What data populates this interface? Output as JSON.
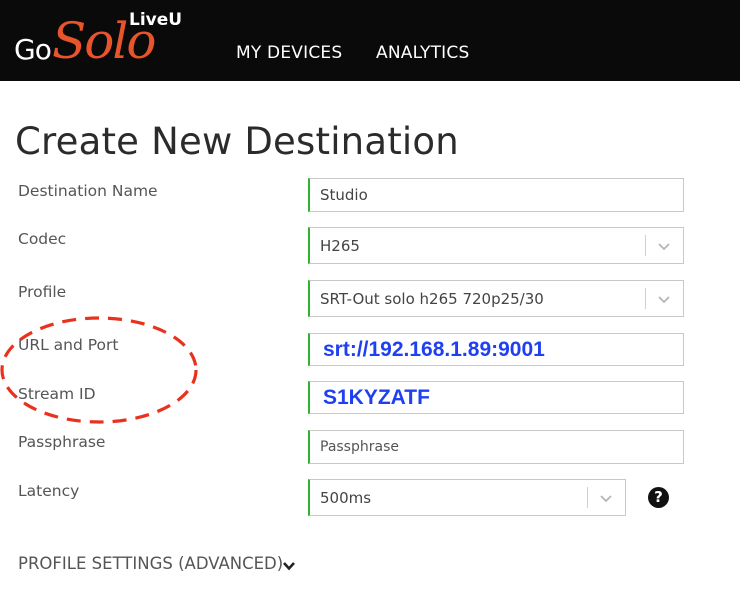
{
  "brand": {
    "go": "Go",
    "solo": "Solo",
    "liveu": "LiveU",
    "accent_color": "#e8542b"
  },
  "nav": {
    "items": [
      "MY DEVICES",
      "ANALYTICS"
    ]
  },
  "page": {
    "title": "Create New Destination"
  },
  "form": {
    "destination_name": {
      "label": "Destination Name",
      "value": "Studio"
    },
    "codec": {
      "label": "Codec",
      "value": "H265"
    },
    "profile": {
      "label": "Profile",
      "value": "SRT-Out solo h265 720p25/30"
    },
    "url_port": {
      "label": "URL and Port",
      "value": "srt://192.168.1.89:9001"
    },
    "stream_id": {
      "label": "Stream ID",
      "value": "S1KYZATF"
    },
    "passphrase": {
      "label": "Passphrase",
      "placeholder": "Passphrase"
    },
    "latency": {
      "label": "Latency",
      "value": "500ms"
    },
    "valid_color": "#2db52d",
    "help_icon": "question-circle-icon"
  },
  "advanced": {
    "label": "PROFILE SETTINGS (ADVANCED)",
    "icon": "chevron-down-icon"
  },
  "annotation": {
    "shape": "dashed-ellipse",
    "color": "#e8321e"
  }
}
